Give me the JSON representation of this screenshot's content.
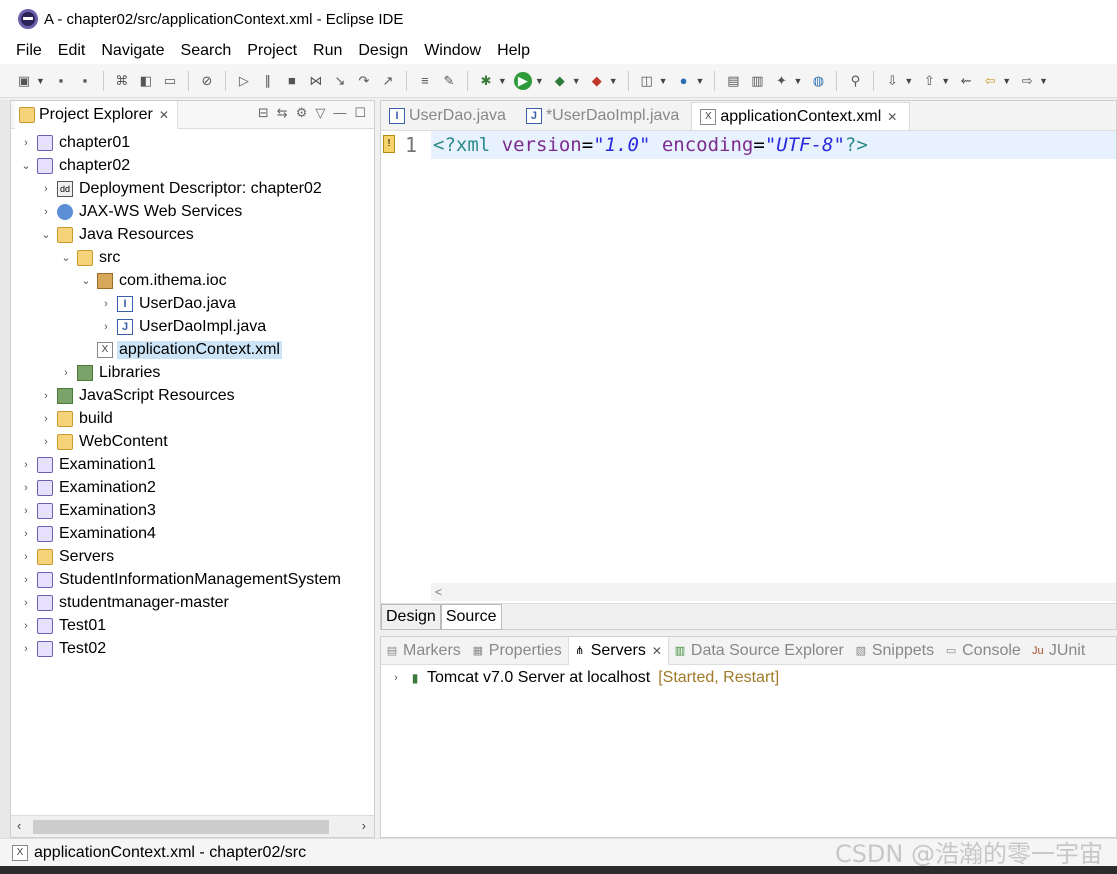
{
  "window": {
    "title": "A - chapter02/src/applicationContext.xml - Eclipse IDE"
  },
  "menu": [
    "File",
    "Edit",
    "Navigate",
    "Search",
    "Project",
    "Run",
    "Design",
    "Window",
    "Help"
  ],
  "project_explorer": {
    "tab_label": "Project Explorer",
    "tree": [
      {
        "label": "chapter01",
        "depth": 0,
        "twisty": "›",
        "icon": "project-icon"
      },
      {
        "label": "chapter02",
        "depth": 0,
        "twisty": "⌄",
        "icon": "project-icon"
      },
      {
        "label": "Deployment Descriptor: chapter02",
        "depth": 1,
        "twisty": "›",
        "icon": "deployment-descriptor-icon"
      },
      {
        "label": "JAX-WS Web Services",
        "depth": 1,
        "twisty": "›",
        "icon": "web-services-icon"
      },
      {
        "label": "Java Resources",
        "depth": 1,
        "twisty": "⌄",
        "icon": "java-resources-icon"
      },
      {
        "label": "src",
        "depth": 2,
        "twisty": "⌄",
        "icon": "source-folder-icon"
      },
      {
        "label": "com.ithema.ioc",
        "depth": 3,
        "twisty": "⌄",
        "icon": "package-icon"
      },
      {
        "label": "UserDao.java",
        "depth": 4,
        "twisty": "›",
        "icon": "java-interface-icon"
      },
      {
        "label": "UserDaoImpl.java",
        "depth": 4,
        "twisty": "›",
        "icon": "java-file-icon"
      },
      {
        "label": "applicationContext.xml",
        "depth": 3,
        "twisty": "",
        "icon": "xml-file-icon",
        "selected": true
      },
      {
        "label": "Libraries",
        "depth": 2,
        "twisty": "›",
        "icon": "libraries-icon"
      },
      {
        "label": "JavaScript Resources",
        "depth": 1,
        "twisty": "›",
        "icon": "javascript-resources-icon"
      },
      {
        "label": "build",
        "depth": 1,
        "twisty": "›",
        "icon": "folder-icon"
      },
      {
        "label": "WebContent",
        "depth": 1,
        "twisty": "›",
        "icon": "folder-icon"
      },
      {
        "label": "Examination1",
        "depth": 0,
        "twisty": "›",
        "icon": "project-icon"
      },
      {
        "label": "Examination2",
        "depth": 0,
        "twisty": "›",
        "icon": "project-error-icon"
      },
      {
        "label": "Examination3",
        "depth": 0,
        "twisty": "›",
        "icon": "project-icon"
      },
      {
        "label": "Examination4",
        "depth": 0,
        "twisty": "›",
        "icon": "project-icon"
      },
      {
        "label": "Servers",
        "depth": 0,
        "twisty": "›",
        "icon": "folder-icon"
      },
      {
        "label": "StudentInformationManagementSystem",
        "depth": 0,
        "twisty": "›",
        "icon": "project-icon"
      },
      {
        "label": "studentmanager-master",
        "depth": 0,
        "twisty": "›",
        "icon": "project-icon"
      },
      {
        "label": "Test01",
        "depth": 0,
        "twisty": "›",
        "icon": "project-icon"
      },
      {
        "label": "Test02",
        "depth": 0,
        "twisty": "›",
        "icon": "project-icon"
      }
    ]
  },
  "editor": {
    "tabs": [
      {
        "label": "UserDao.java",
        "active": false,
        "icon": "java-interface-icon"
      },
      {
        "label": "*UserDaoImpl.java",
        "active": false,
        "icon": "java-file-icon"
      },
      {
        "label": "applicationContext.xml",
        "active": true,
        "icon": "xml-file-icon"
      }
    ],
    "line_number": "1",
    "code": {
      "open": "<?xml",
      "attr1": "version",
      "eq": "=",
      "val1": "\"1.0\"",
      "attr2": "encoding",
      "val2": "\"UTF-8\"",
      "close": "?>"
    },
    "hscroll_arrow": "<",
    "bottom_tabs": [
      "Design",
      "Source"
    ],
    "active_bottom_tab": "Source"
  },
  "bottom_panel": {
    "tabs": [
      {
        "label": "Markers",
        "icon": "markers-icon",
        "active": false
      },
      {
        "label": "Properties",
        "icon": "properties-icon",
        "active": false
      },
      {
        "label": "Servers",
        "icon": "servers-icon",
        "active": true
      },
      {
        "label": "Data Source Explorer",
        "icon": "data-source-icon",
        "active": false
      },
      {
        "label": "Snippets",
        "icon": "snippets-icon",
        "active": false
      },
      {
        "label": "Console",
        "icon": "console-icon",
        "active": false
      },
      {
        "label": "JUnit",
        "icon": "junit-icon",
        "active": false
      }
    ],
    "server": {
      "name": "Tomcat v7.0 Server at localhost",
      "status": "[Started, Restart]"
    }
  },
  "statusbar": {
    "text": "applicationContext.xml - chapter02/src"
  },
  "watermark": "CSDN @浩瀚的零一宇宙",
  "colors": {
    "selection": "#cce4f7",
    "current_line": "#e8f2fe",
    "xml_value": "#2a2ae0",
    "xml_attr": "#7b2c8e",
    "server_status": "#a07a2a"
  }
}
